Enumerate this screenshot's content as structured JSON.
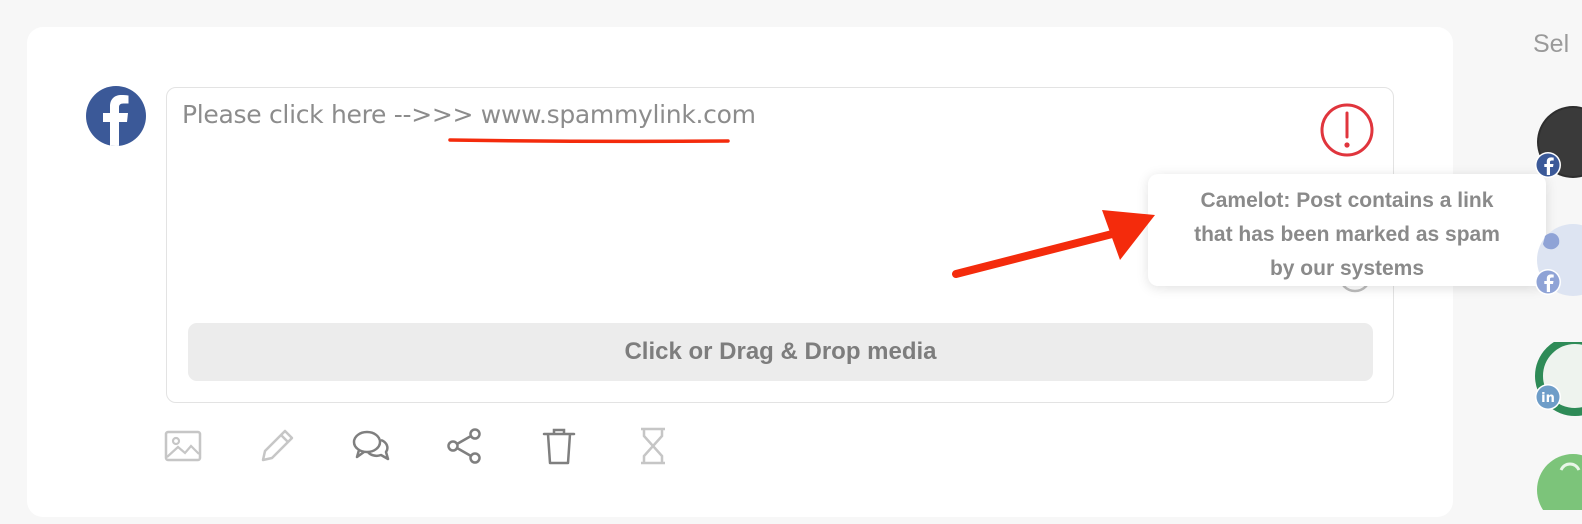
{
  "post": {
    "network_icon": "facebook-icon",
    "text_prefix": "Please click here -->>> ",
    "text_link": "www.spammylink.com"
  },
  "warning": {
    "icon": "exclamation-circle-icon",
    "tooltip_line1": "Camelot: Post contains a link",
    "tooltip_line2": "that has been marked as spam",
    "tooltip_line3": "by our systems",
    "color": "#e0353d"
  },
  "annotation": {
    "arrow_color": "#f42b0c",
    "underline_color": "#f42b0c"
  },
  "media": {
    "dropzone_label": "Click or Drag & Drop media"
  },
  "toolbar": {
    "items": [
      "image-icon",
      "pencil-icon",
      "comments-icon",
      "share-icon",
      "trash-icon",
      "hourglass-icon"
    ]
  },
  "sidebar": {
    "label": "Sel",
    "accounts": [
      {
        "network": "facebook"
      },
      {
        "network": "facebook"
      },
      {
        "network": "linkedin"
      },
      {
        "network": "unknown"
      }
    ]
  }
}
